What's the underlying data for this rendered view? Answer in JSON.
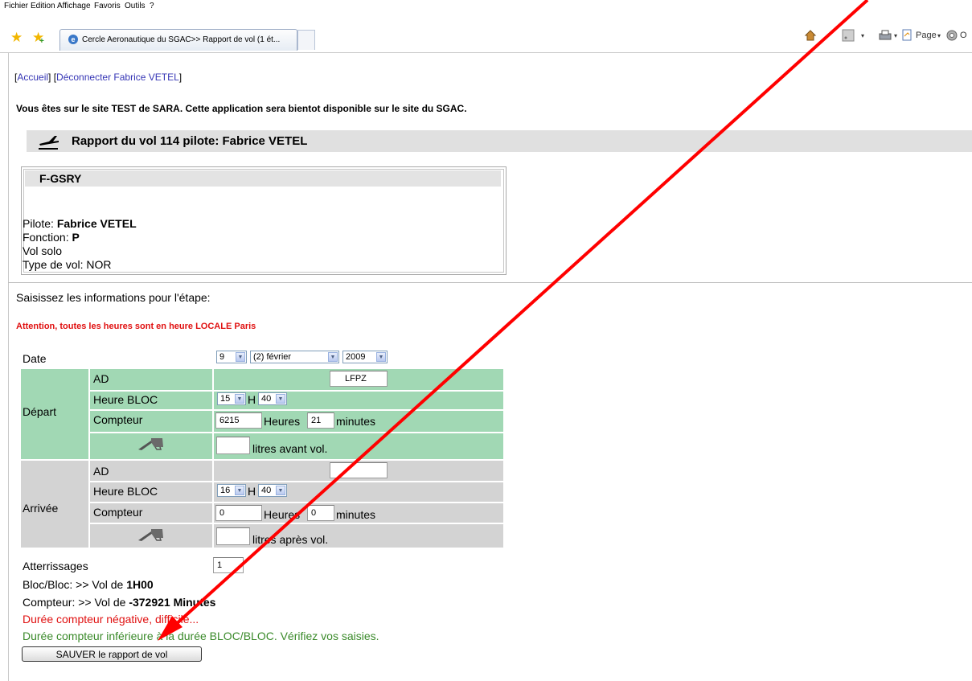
{
  "menu": [
    "Fichier",
    "Edition",
    "Affichage",
    "Favoris",
    "Outils",
    "?"
  ],
  "browser": {
    "tab_title": "Cercle Aeronautique du SGAC>> Rapport de vol (1 ét...",
    "page_label": "Page",
    "tools_fragment": "O"
  },
  "nav": {
    "accueil": "Accueil",
    "deconnecter": "Déconnecter Fabrice VETEL"
  },
  "notice": "Vous êtes sur le site TEST de SARA. Cette application sera bientot disponible sur le site du SGAC.",
  "report_title": "Rapport du vol 114 pilote: Fabrice VETEL",
  "aircraft": {
    "registration": "F-GSRY",
    "pilote_label": "Pilote:",
    "pilote_value": "Fabrice VETEL",
    "fonction_label": "Fonction:",
    "fonction_value": "P",
    "vol_solo": "Vol solo",
    "type_label": "Type de vol:",
    "type_value": "NOR"
  },
  "instructions": "Saisissez les informations pour l'étape:",
  "warning": "Attention, toutes les heures sont en heure LOCALE Paris",
  "form": {
    "date_label": "Date",
    "date_day": "9",
    "date_month": "(2) février",
    "date_year": "2009",
    "depart": {
      "label": "Départ",
      "ad_label": "AD",
      "ad_value": "LFPZ",
      "bloc_label": "Heure BLOC",
      "bloc_hour": "15",
      "bloc_min": "40",
      "h_sep": "H",
      "compteur_label": "Compteur",
      "compteur_hours": "6215",
      "heures_label": "Heures",
      "compteur_minutes": "21",
      "minutes_label": "minutes",
      "fuel_value": "",
      "fuel_label": "litres avant vol."
    },
    "arrivee": {
      "label": "Arrivée",
      "ad_label": "AD",
      "ad_value": "",
      "bloc_label": "Heure BLOC",
      "bloc_hour": "16",
      "bloc_min": "40",
      "h_sep": "H",
      "compteur_label": "Compteur",
      "compteur_hours": "0",
      "heures_label": "Heures",
      "compteur_minutes": "0",
      "minutes_label": "minutes",
      "fuel_value": "",
      "fuel_label": "litres après vol."
    },
    "atterrissages_label": "Atterrissages",
    "atterrissages_value": "1"
  },
  "results": {
    "bloc_prefix": "Bloc/Bloc: >> Vol de ",
    "bloc_value": "1H00",
    "compteur_prefix": "Compteur: >> Vol de ",
    "compteur_value": "-372921 Minutes",
    "error_negative": "Durée compteur négative, difficile...",
    "error_inferior": "Durée compteur inférieure à la durée BLOC/BLOC. Vérifiez vos saisies."
  },
  "save_button": "SAUVER le rapport de vol",
  "colors": {
    "link": "#3535b5",
    "warning_red": "#e01010",
    "ok_green": "#3a8a2a",
    "depart_green": "#a1d8b4",
    "arrivee_gray": "#d3d3d3",
    "annotation_arrow": "#ff0000"
  }
}
